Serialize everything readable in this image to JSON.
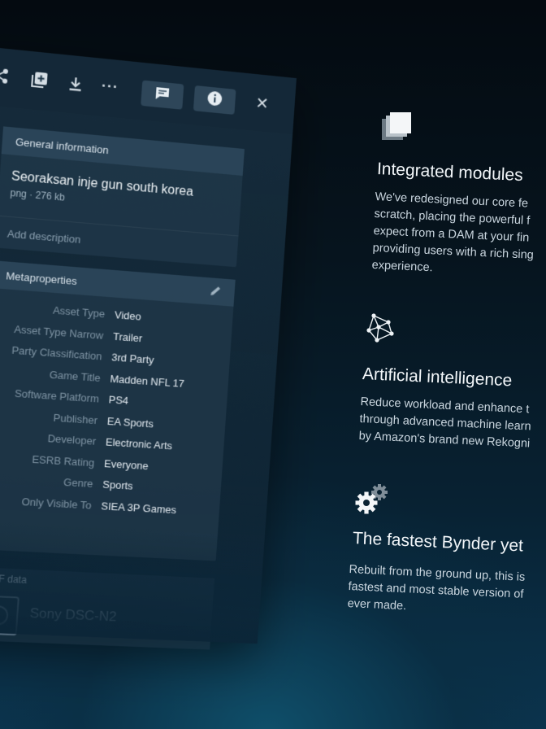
{
  "toolbar": {
    "icons": [
      "share-icon",
      "add-to-collection-icon",
      "download-icon",
      "more-icon",
      "comments-icon",
      "info-icon",
      "close-icon"
    ],
    "more_glyph": "···",
    "close_glyph": "✕"
  },
  "general": {
    "header": "General information",
    "asset_title": "Seoraksan inje gun south korea",
    "asset_meta": "png · 276 kb",
    "description_placeholder": "Add description"
  },
  "metaproperties": {
    "header": "Metaproperties",
    "rows": [
      {
        "label": "Asset Type",
        "value": "Video"
      },
      {
        "label": "Asset Type Narrow",
        "value": "Trailer"
      },
      {
        "label": "Party Classification",
        "value": "3rd Party"
      },
      {
        "label": "Game Title",
        "value": "Madden NFL 17"
      },
      {
        "label": "Software Platform",
        "value": "PS4"
      },
      {
        "label": "Publisher",
        "value": "EA Sports"
      },
      {
        "label": "Developer",
        "value": "Electronic Arts"
      },
      {
        "label": "ESRB Rating",
        "value": "Everyone"
      },
      {
        "label": "Genre",
        "value": "Sports"
      },
      {
        "label": "Only Visible To",
        "value": "SIEA 3P Games"
      }
    ]
  },
  "exif": {
    "header": "EXIF data",
    "camera": "Sony DSC-N2"
  },
  "features": [
    {
      "title": "Integrated modules",
      "icon": "stacked-layers-icon",
      "body": "We've redesigned our core fe\nscratch, placing the powerful f\nexpect from a DAM at your fin\nproviding users with a rich sing\nexperience."
    },
    {
      "title": "Artificial intelligence",
      "icon": "neural-network-icon",
      "body": "Reduce workload and enhance t\nthrough advanced machine learn\nby Amazon's brand new Rekogni"
    },
    {
      "title": "The fastest Bynder yet",
      "icon": "gears-icon",
      "body": "Rebuilt from the ground up, this is\nfastest and most stable version of\never made."
    }
  ],
  "colors": {
    "background_top": "#040a10",
    "background_bottom": "#0b3550",
    "panel": "#16303f",
    "toolbar_button": "#2e4659"
  }
}
